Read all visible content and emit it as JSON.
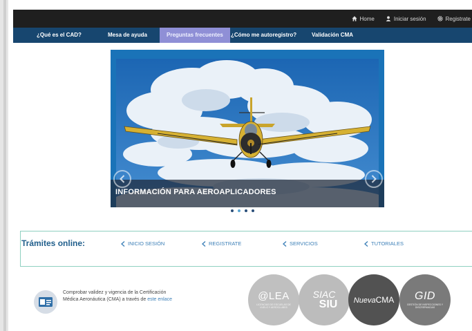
{
  "topbar": {
    "links": [
      {
        "label": "Home",
        "icon": "home-icon"
      },
      {
        "label": "Iniciar sesión",
        "icon": "user-icon"
      },
      {
        "label": "Registrate",
        "icon": "gear-icon"
      }
    ]
  },
  "navbar": {
    "items": [
      {
        "label": "¿Qué es el CAD?"
      },
      {
        "label": "Mesa de ayuda"
      },
      {
        "label": "Preguntas frecuentes",
        "active": true
      },
      {
        "label": "¿Cómo me autoregistro?"
      },
      {
        "label": "Validación CMA"
      }
    ]
  },
  "carousel": {
    "caption": "INFORMACIÓN PARA AEROAPLICADORES",
    "slide_count": 4,
    "active_slide": 2
  },
  "tramites": {
    "title": "Trámites online:",
    "links": [
      {
        "label": "INICIO SESIÓN"
      },
      {
        "label": "REGISTRATE"
      },
      {
        "label": "SERVICIOS"
      },
      {
        "label": "TUTORIALES"
      }
    ]
  },
  "cma": {
    "text": "Comprobar validez y vigencia de la Certificación Médica Aeronáutica (CMA) a través de",
    "link": "este enlace"
  },
  "logos": {
    "lea": {
      "name": "@LEA",
      "subtitle": "LICENCIAS DE ESCUELAS DE VUELO Y AEROCLUBES"
    },
    "siac": {
      "line1": "SIAC",
      "line2": "SIU"
    },
    "cma": {
      "prefix": "Nueva",
      "name": "CMA"
    },
    "gid": {
      "name": "GID",
      "subtitle": "GESTIÓN DE INSPECCIONES Y DISCREPANCIAS"
    }
  },
  "colors": {
    "topbar": "#1f1f1f",
    "navbar": "#17466f",
    "nav_active": "#8f8fd6",
    "accent": "#3c7fb7",
    "tramites_border": "#8fd0c0"
  }
}
